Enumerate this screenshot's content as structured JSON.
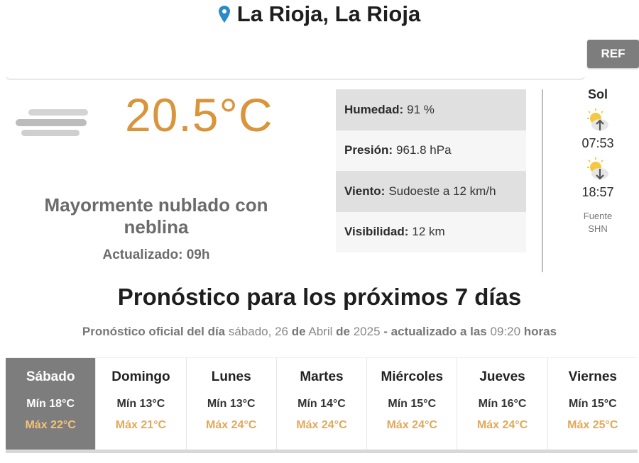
{
  "location": {
    "title": "La Rioja, La Rioja",
    "icon": "map-pin-icon"
  },
  "ref_button": "REF",
  "current": {
    "temperature": "20.5°C",
    "condition": "Mayormente nublado con neblina",
    "updated_label": "Actualizado:",
    "updated_value": "09h",
    "icon": "fog-icon"
  },
  "stats": [
    {
      "label": "Humedad:",
      "value": "91 %"
    },
    {
      "label": "Presión:",
      "value": "961.8 hPa"
    },
    {
      "label": "Viento:",
      "value": "Sudoeste a 12 km/h"
    },
    {
      "label": "Visibilidad:",
      "value": "12 km"
    }
  ],
  "sun": {
    "title": "Sol",
    "sunrise": "07:53",
    "sunset": "18:57",
    "source_line1": "Fuente",
    "source_line2": "SHN"
  },
  "forecast": {
    "title": "Pronóstico para los próximos 7 días",
    "sub_prefix": "Pronóstico oficial del día",
    "sub_weekday": "sábado, 26",
    "sub_de1": "de",
    "sub_month": "Abril",
    "sub_de2": "de",
    "sub_year": "2025",
    "sub_updated": "- actualizado a las",
    "sub_time": "09:20",
    "sub_hours": "horas",
    "days": [
      {
        "name": "Sábado",
        "min": "Mín 18°C",
        "max": "Máx 22°C"
      },
      {
        "name": "Domingo",
        "min": "Mín 13°C",
        "max": "Máx 21°C"
      },
      {
        "name": "Lunes",
        "min": "Mín 13°C",
        "max": "Máx 24°C"
      },
      {
        "name": "Martes",
        "min": "Mín 14°C",
        "max": "Máx 24°C"
      },
      {
        "name": "Miércoles",
        "min": "Mín 15°C",
        "max": "Máx 24°C"
      },
      {
        "name": "Jueves",
        "min": "Mín 16°C",
        "max": "Máx 24°C"
      },
      {
        "name": "Viernes",
        "min": "Mín 15°C",
        "max": "Máx 25°C"
      }
    ]
  },
  "colors": {
    "temp": "#d9953b",
    "max": "#e3a85a",
    "active_day": "#7d7d7d"
  }
}
